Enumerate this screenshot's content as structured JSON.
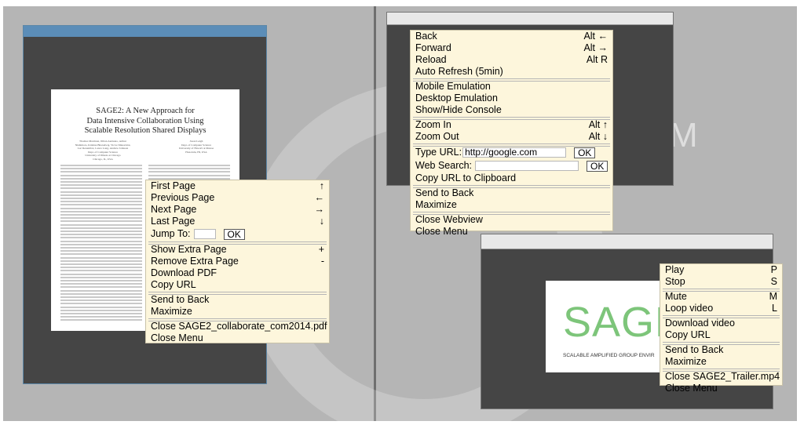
{
  "pdf_viewer": {
    "document": {
      "title": "SAGE2: A New Approach for\nData Intensive Collaboration Using\nScalable Resolution Shared Displays",
      "authors": "Thomas Marrinan, Jillian Aurisano, Arthur\nNishimoto, Krishna Bharadwaj, Victor Mateevitsi,\nLuc Renambot, Lance Long, Andrew Johnson\nDept. of Computer Science\nUniversity of Illinois at Chicago\nChicago, IL, USA",
      "author2": "Jason Leigh\nDept. of Computer Science\nUniversity of Hawai'i at Manoa\nHonolulu, HI, USA"
    },
    "menu": {
      "items": [
        {
          "label": "First Page",
          "shortcut": "↑"
        },
        {
          "label": "Previous Page",
          "shortcut": "←"
        },
        {
          "label": "Next Page",
          "shortcut": "→"
        },
        {
          "label": "Last Page",
          "shortcut": "↓"
        }
      ],
      "jump_label": "Jump To:",
      "jump_value": "",
      "ok_label": "OK",
      "group2": [
        {
          "label": "Show Extra Page",
          "shortcut": "+"
        },
        {
          "label": "Remove Extra Page",
          "shortcut": "-"
        },
        {
          "label": "Download PDF",
          "shortcut": ""
        },
        {
          "label": "Copy URL",
          "shortcut": ""
        }
      ],
      "send_to_back": "Send to Back",
      "maximize": "Maximize",
      "close_app": "Close SAGE2_collaborate_com2014.pdf",
      "close_menu": "Close Menu"
    }
  },
  "webview": {
    "menu": {
      "nav": [
        {
          "label": "Back",
          "shortcut": "Alt ←"
        },
        {
          "label": "Forward",
          "shortcut": "Alt →"
        },
        {
          "label": "Reload",
          "shortcut": "Alt R"
        },
        {
          "label": "Auto Refresh (5min)",
          "shortcut": ""
        }
      ],
      "emulation": [
        {
          "label": "Mobile Emulation",
          "shortcut": ""
        },
        {
          "label": "Desktop Emulation",
          "shortcut": ""
        },
        {
          "label": "Show/Hide Console",
          "shortcut": ""
        }
      ],
      "zoom": [
        {
          "label": "Zoom In",
          "shortcut": "Alt ↑"
        },
        {
          "label": "Zoom Out",
          "shortcut": "Alt ↓"
        }
      ],
      "type_url_label": "Type URL:",
      "type_url_value": "http://google.com",
      "web_search_label": "Web Search:",
      "web_search_value": "",
      "ok_label": "OK",
      "copy_url": "Copy URL to Clipboard",
      "send_to_back": "Send to Back",
      "maximize": "Maximize",
      "close_app": "Close Webview",
      "close_menu": "Close Menu"
    }
  },
  "video": {
    "frame": {
      "logo_text": "SAGE",
      "logo_sub": "SCALABLE AMPLIFIED GROUP ENVIR"
    },
    "menu": {
      "playback": [
        {
          "label": "Play",
          "shortcut": "P"
        },
        {
          "label": "Stop",
          "shortcut": "S"
        }
      ],
      "audio": [
        {
          "label": "Mute",
          "shortcut": "M"
        },
        {
          "label": "Loop video",
          "shortcut": "L"
        }
      ],
      "download": [
        {
          "label": "Download video",
          "shortcut": ""
        },
        {
          "label": "Copy URL",
          "shortcut": ""
        }
      ],
      "send_to_back": "Send to Back",
      "maximize": "Maximize",
      "close_app": "Close SAGE2_Trailer.mp4",
      "close_menu": "Close Menu"
    }
  },
  "background": {
    "watermark_text": "M"
  },
  "colors": {
    "menu_bg": "#fdf6dc",
    "panel_bg": "#b5b5b5",
    "app_bg": "#454545",
    "pdf_titlebar": "#5b8db8",
    "sage_green": "#7dc57a"
  }
}
